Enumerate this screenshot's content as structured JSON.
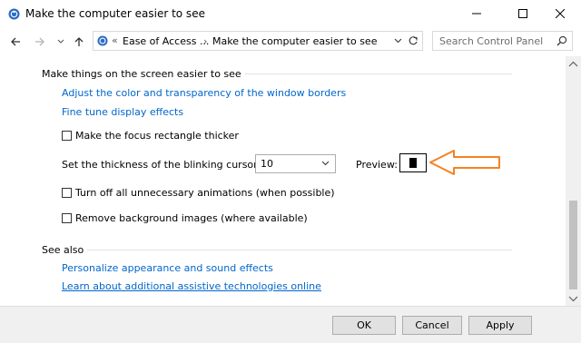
{
  "window": {
    "title": "Make the computer easier to see",
    "icon": "control-panel-ease-of-access-icon"
  },
  "address": {
    "overflow": "«",
    "crumbs": [
      "Ease of Access ...",
      "Make the computer easier to see"
    ],
    "search_placeholder": "Search Control Panel"
  },
  "section1": {
    "title": "Make things on the screen easier to see",
    "links": [
      "Adjust the color and transparency of the window borders",
      "Fine tune display effects"
    ],
    "focus_rect_label": "Make the focus rectangle thicker",
    "focus_rect_checked": false,
    "cursor_thickness_label": "Set the thickness of the blinking cursor:",
    "cursor_thickness_value": "10",
    "preview_label": "Preview:",
    "animations_label": "Turn off all unnecessary animations (when possible)",
    "animations_checked": false,
    "backgrounds_label": "Remove background images (where available)",
    "backgrounds_checked": false
  },
  "see_also": {
    "title": "See also",
    "links": [
      "Personalize appearance and sound effects",
      "Learn about additional assistive technologies online"
    ]
  },
  "buttons": {
    "ok": "OK",
    "cancel": "Cancel",
    "apply": "Apply"
  },
  "colors": {
    "link": "#0066cc",
    "annotation_arrow": "#f58220",
    "footer_bg": "#f0f0f0"
  }
}
